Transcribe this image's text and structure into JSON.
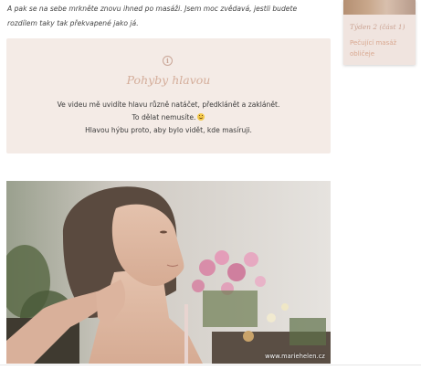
{
  "intro": {
    "text": "A pak se na sebe mrkněte znovu ihned po masáži. Jsem moc zvědavá, jestli budete rozdílem taky tak překvapené jako já."
  },
  "info_box": {
    "icon": "info-icon",
    "title": "Pohyby hlavou",
    "lines": [
      "Ve videu mě uvidíte hlavu různě natáčet, předklánět a zaklánět.",
      "To dělat nemusíte.",
      "Hlavou hýbu proto, aby bylo vidět, kde masíruji."
    ]
  },
  "sidebar": {
    "card_title": "Týden 2 (část 1)",
    "card_subtitle": "Pečující masáž obličeje"
  },
  "video": {
    "watermark": "www.mariehelen.cz"
  },
  "colors": {
    "box_background": "#f4ebe6",
    "accent": "#d4ad9a"
  }
}
